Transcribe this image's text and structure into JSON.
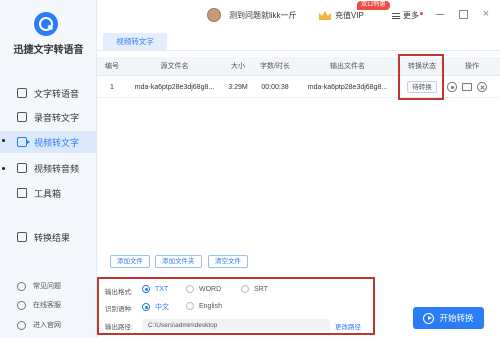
{
  "app": {
    "name": "迅捷文字转语音"
  },
  "sidebar": {
    "items": [
      {
        "label": "文字转语音",
        "icon": "text-speech-icon"
      },
      {
        "label": "录音转文字",
        "icon": "record-icon"
      },
      {
        "label": "视频转文字",
        "icon": "video-icon",
        "active": true
      },
      {
        "label": "视频转音频",
        "icon": "audio-icon"
      },
      {
        "label": "工具箱",
        "icon": "toolbox-icon"
      },
      {
        "label": "转换结果",
        "icon": "result-icon"
      }
    ],
    "bottom_links": [
      {
        "label": "常见问题",
        "icon": "question-icon"
      },
      {
        "label": "在线客服",
        "icon": "service-icon"
      },
      {
        "label": "进入官网",
        "icon": "website-icon"
      }
    ]
  },
  "topbar": {
    "username": "测到问题就likk一斤",
    "vip_label": "充值VIP",
    "vip_badge": "双12特惠",
    "more_label": "更多",
    "close_glyph": "×"
  },
  "tab": {
    "label": "视频转文字"
  },
  "table": {
    "headers": {
      "index": "编号",
      "source": "源文件名",
      "size": "大小",
      "duration": "字数/时长",
      "output": "输出文件名",
      "status": "转换状态",
      "action": "操作"
    },
    "rows": [
      {
        "index": "1",
        "source": "mda-ka6ptp28e3dj68g8...",
        "size": "3.29M",
        "duration": "00:00:38",
        "output": "mda-ka6ptp28e3dj68g8...",
        "status": "待转换"
      }
    ]
  },
  "buttons": {
    "add_file": "添加文件",
    "add_folder": "添加文件夹",
    "clear_file": "清空文件",
    "start": "开始转换"
  },
  "settings": {
    "format_label": "输出格式:",
    "format_options": [
      "TXT",
      "WORD",
      "SRT"
    ],
    "format_selected": "TXT",
    "lang_label": "识别语种:",
    "lang_options": [
      "中文",
      "English"
    ],
    "lang_selected": "中文",
    "path_label": "输出路径:",
    "path_value": "C:\\Users\\admin\\desktop",
    "change_path": "更改路径"
  },
  "colors": {
    "accent": "#2a7df6",
    "highlight_border": "#c0352f"
  }
}
